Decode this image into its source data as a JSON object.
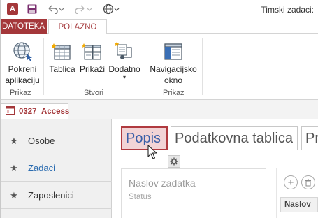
{
  "window": {
    "title": "Timski zadaci:"
  },
  "ribbon": {
    "tabs": [
      {
        "label": "DATOTEKA"
      },
      {
        "label": "POLAZNO"
      }
    ],
    "buttons": {
      "launch_app": "Pokreni aplikaciju",
      "table": "Tablica",
      "views": "Prikaži",
      "addons": "Dodatno",
      "nav_pane": "Navigacijsko okno"
    },
    "groups": {
      "view": "Prikaz",
      "create": "Stvori",
      "show": "Prikaz"
    }
  },
  "doc_tab": {
    "label": "0327_Access"
  },
  "nav": {
    "items": [
      {
        "label": "Osobe"
      },
      {
        "label": "Zadaci"
      },
      {
        "label": "Zaposlenici"
      }
    ]
  },
  "view_tabs": [
    {
      "label": "Popis"
    },
    {
      "label": "Podatkovna tablica"
    },
    {
      "label": "Pr"
    }
  ],
  "card": {
    "title": "Naslov zadatka",
    "status": "Status"
  },
  "column_header": "Naslov",
  "colors": {
    "accent": "#a4373a",
    "selected_tab_fill": "#f2d4d6",
    "link_blue": "#2b6cb0"
  }
}
